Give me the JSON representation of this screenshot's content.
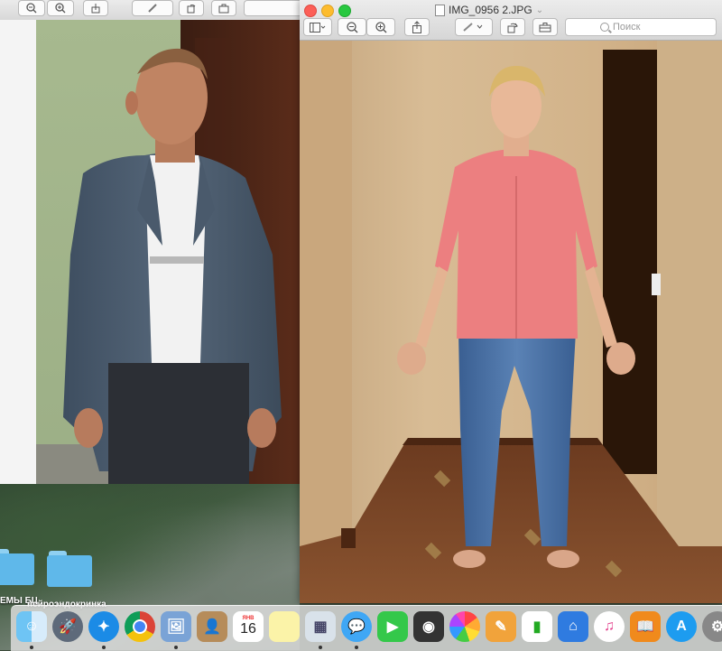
{
  "right_window": {
    "title": "IMG_0956 2.JPG",
    "title_chevron": "⌄",
    "search_placeholder": "Поиск",
    "toolbar": {
      "sidebar_btn": "sidebar-toggle-icon",
      "zoom_out": "zoom-out-icon",
      "zoom_in": "zoom-in-icon",
      "share": "share-icon",
      "markup": "markup-pen-icon",
      "rotate": "rotate-icon",
      "toolbox": "toolbox-icon"
    }
  },
  "left_window": {
    "toolbar_icons": [
      "zoom-out-icon",
      "zoom-in-icon",
      "share-icon",
      "markup-pen-icon",
      "rotate-icon",
      "toolbox-icon"
    ]
  },
  "desktop": {
    "folder_labels": [
      "ЕМЫ БЦ",
      "нейроэндокринка"
    ]
  },
  "dock": {
    "calendar_month": "ЯНВ",
    "calendar_day": "16",
    "items": [
      "finder",
      "launchpad",
      "safari",
      "chrome",
      "preview",
      "contacts",
      "calendar",
      "notes",
      "photo-booth",
      "messages",
      "facetime",
      "photo-booth-2",
      "photos",
      "pages",
      "numbers",
      "keynote",
      "itunes",
      "ibooks",
      "app-store",
      "system-preferences"
    ]
  }
}
